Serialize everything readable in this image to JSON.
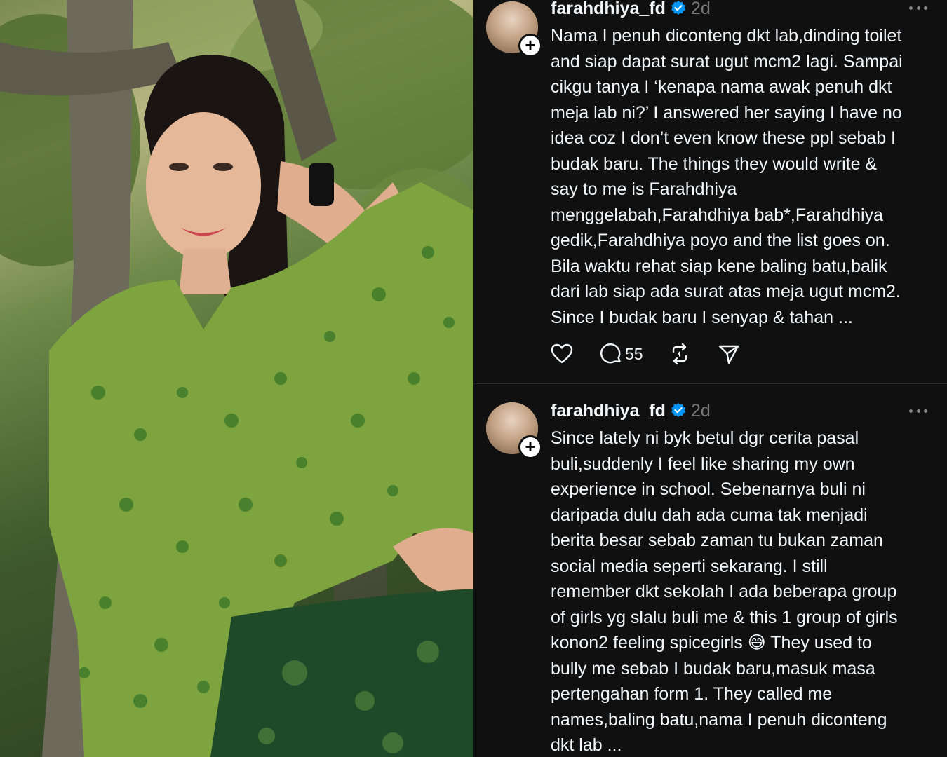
{
  "posts": [
    {
      "username": "farahdhiya_fd",
      "time": "2d",
      "text": "Nama I penuh diconteng dkt lab,dinding toilet\nand siap dapat surat ugut mcm2 lagi. Sampai\ncikgu tanya I ‘kenapa nama awak penuh dkt\nmeja lab ni?’ I answered her saying I have no\nidea coz I don’t even know these ppl sebab I\nbudak baru. The things they would write &\nsay to me is Farahdhiya\nmenggelabah,Farahdhiya bab*,Farahdhiya\ngedik,Farahdhiya poyo and the list goes on.\nBila waktu rehat siap kene baling batu,balik\ndari lab siap ada surat atas meja ugut mcm2.\nSince I budak baru I senyap & tahan ...",
      "comment_count": "55"
    },
    {
      "username": "farahdhiya_fd",
      "time": "2d",
      "text": "Since lately ni byk betul dgr cerita pasal\nbuli,suddenly I feel like sharing my own\nexperience in school. Sebenarnya buli ni\ndaripada dulu dah ada cuma tak menjadi\nberita besar sebab zaman tu bukan zaman\nsocial media seperti sekarang. I still\nremember dkt sekolah I ada beberapa group\nof girls yg slalu buli me & this 1 group of girls\nkonon2 feeling spicegirls 😅 They used to\nbully me sebab I budak baru,masuk masa\npertengahan form 1. They called me\nnames,baling batu,nama I penuh diconteng\ndkt lab ..."
    }
  ],
  "follow_symbol": "+",
  "icons": [
    "heart-icon",
    "comment-icon",
    "repost-icon",
    "share-icon",
    "verified-icon",
    "more-icon"
  ],
  "colors": {
    "background": "#101010",
    "text": "#f3f5f7",
    "muted": "#777777",
    "verified": "#0095f6"
  }
}
